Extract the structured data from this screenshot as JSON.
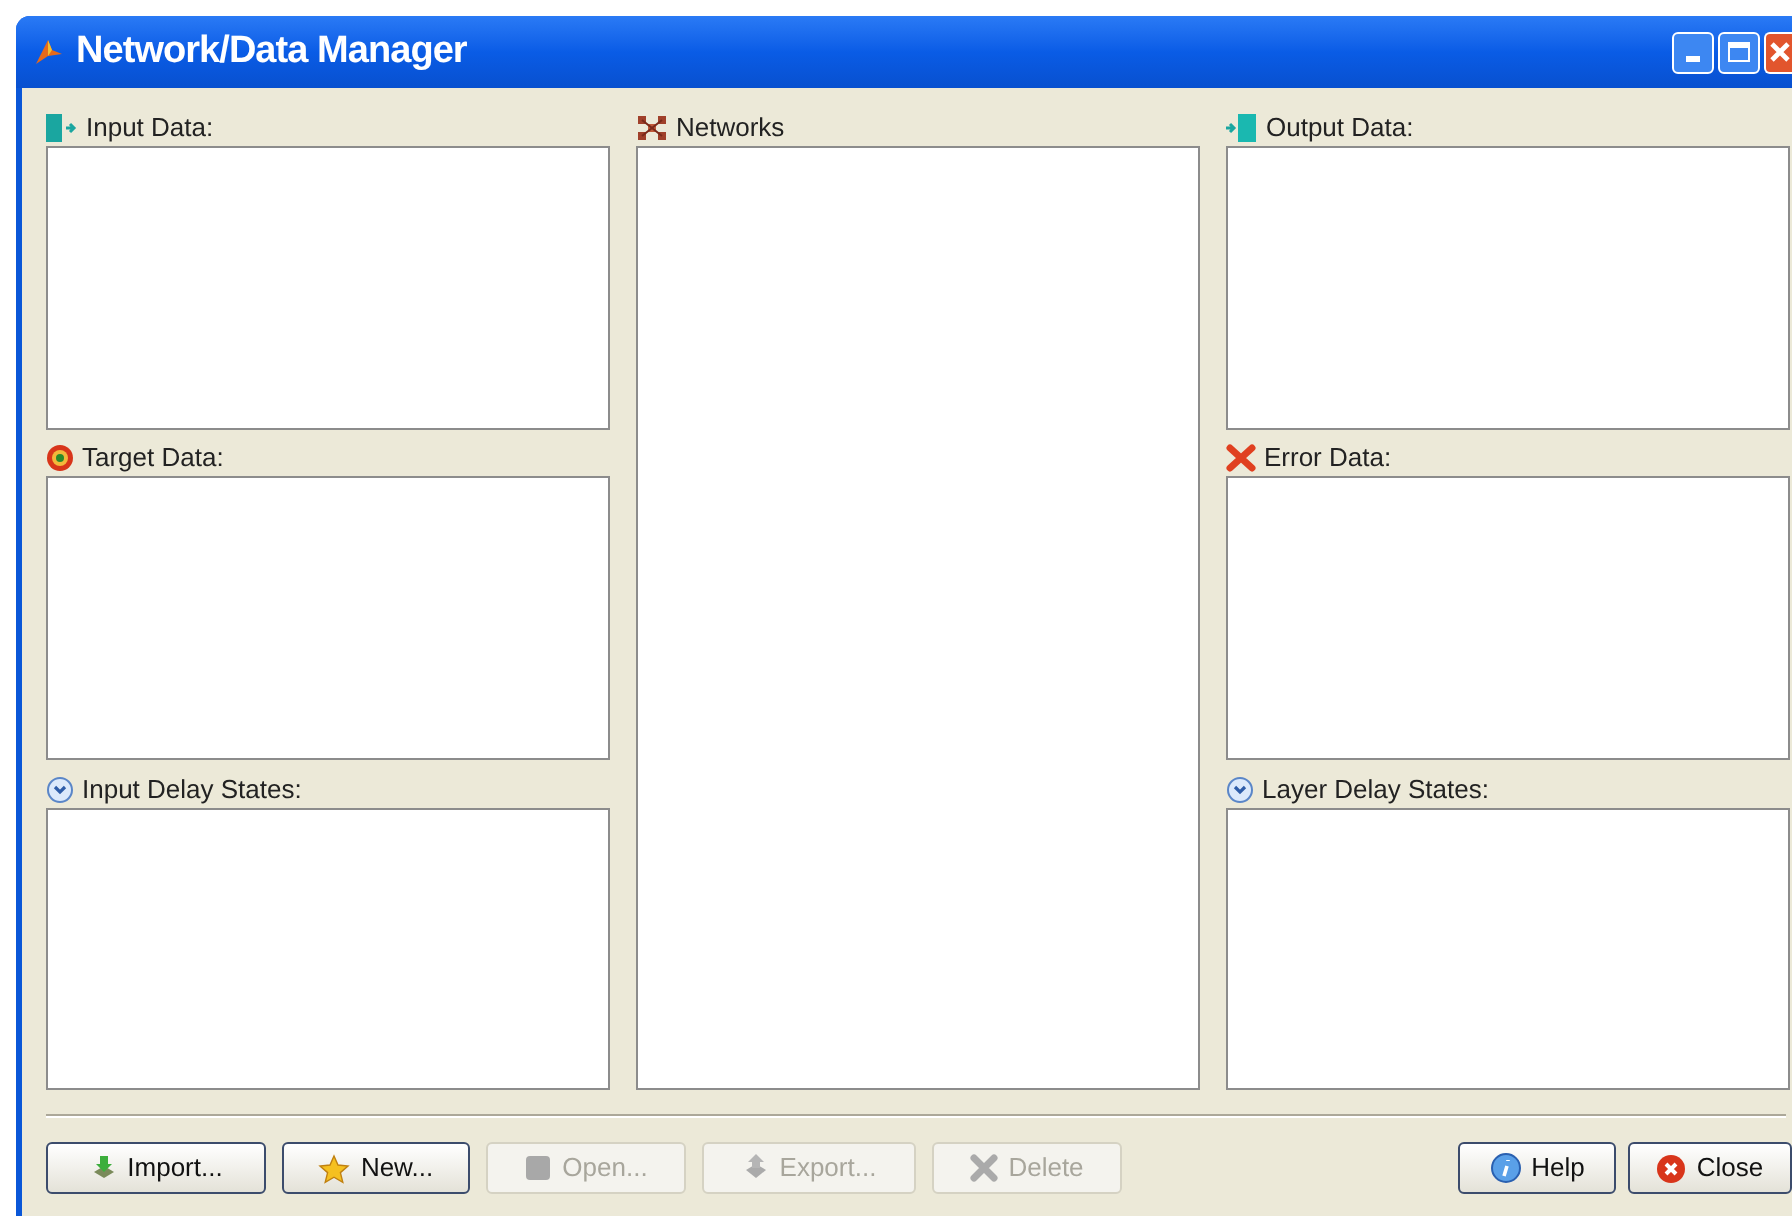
{
  "window": {
    "title": "Network/Data Manager"
  },
  "left_panels": [
    {
      "label": "Input Data:"
    },
    {
      "label": "Target Data:"
    },
    {
      "label": "Input Delay States:"
    }
  ],
  "center_panel": {
    "label": "Networks"
  },
  "right_panels": [
    {
      "label": "Output Data:"
    },
    {
      "label": "Error Data:"
    },
    {
      "label": "Layer Delay States:"
    }
  ],
  "buttons": [
    {
      "label": "Import...",
      "disabled": false
    },
    {
      "label": "New...",
      "disabled": false
    },
    {
      "label": "Open...",
      "disabled": true
    },
    {
      "label": "Export...",
      "disabled": true
    },
    {
      "label": "Delete",
      "disabled": true
    }
  ],
  "right_buttons": [
    {
      "label": "Help",
      "disabled": false
    },
    {
      "label": "Close",
      "disabled": false
    }
  ]
}
